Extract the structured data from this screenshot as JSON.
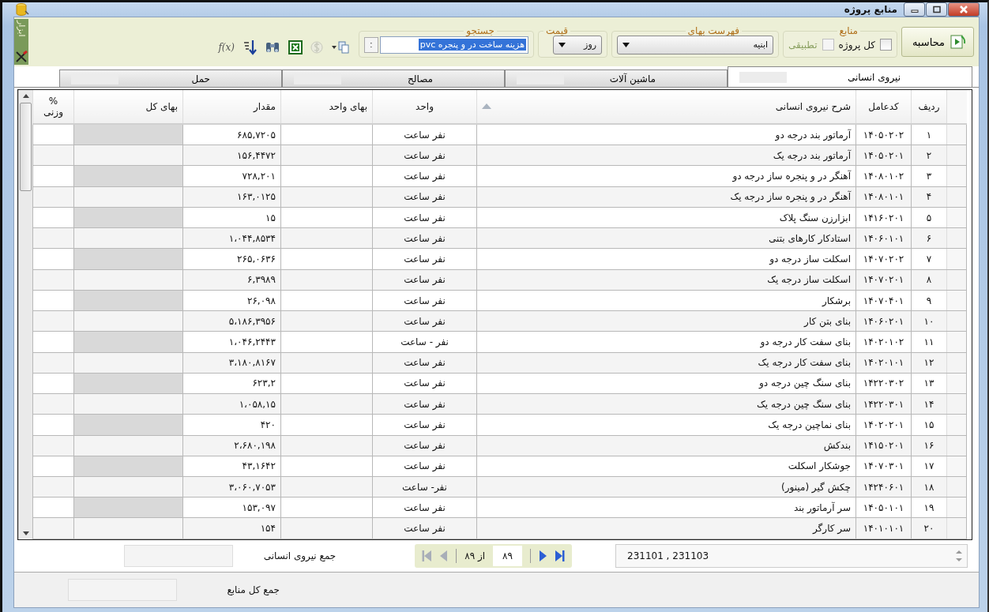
{
  "window": {
    "title": "منابع پروژه"
  },
  "toolbar": {
    "calculate": {
      "label": "محاسبه"
    },
    "resources": {
      "label": "منابع",
      "options": [
        {
          "label": "کل پروژه",
          "checked": false,
          "disabled": false
        },
        {
          "label": "تطبیقی",
          "checked": false,
          "disabled": true
        }
      ]
    },
    "price_list": {
      "label": "فهرست بهای",
      "value": "ابنیه"
    },
    "price": {
      "label": "قیمت",
      "value": "روز"
    },
    "search": {
      "label": "جستجو",
      "value": "هزینه ساخت در و پنجره pvc",
      "highlighted": true,
      "button": ":"
    },
    "tools": [
      {
        "kind": "copy",
        "disabled": false
      },
      {
        "kind": "currency",
        "disabled": true
      },
      {
        "kind": "excel",
        "disabled": false
      },
      {
        "kind": "find",
        "disabled": false
      },
      {
        "kind": "sort",
        "disabled": false
      },
      {
        "kind": "formula",
        "label": "f(x)",
        "disabled": false
      }
    ],
    "tools_panel": {
      "label": "ابزار"
    }
  },
  "tabs": [
    {
      "label": "نیروی انسانی",
      "selected": true
    },
    {
      "label": "ماشین آلات",
      "selected": false
    },
    {
      "label": "مصالح",
      "selected": false
    },
    {
      "label": "حمل",
      "selected": false
    }
  ],
  "table": {
    "columns": [
      {
        "label": "ردیف",
        "sorted": false
      },
      {
        "label": "کدعامل",
        "sorted": false
      },
      {
        "label": "شرح نیروی انسانی",
        "sorted": true
      },
      {
        "label": "واحد",
        "sorted": false
      },
      {
        "label": "بهای واحد",
        "sorted": false
      },
      {
        "label": "مقدار",
        "sorted": false
      },
      {
        "label": "بهای کل",
        "sorted": false
      },
      {
        "label": "%\nوزنی",
        "sorted": false
      }
    ],
    "rows": [
      {
        "row": "۱",
        "code": "۱۴۰۵۰۲۰۲",
        "description": "آرماتور بند درجه دو",
        "unit": "نفر ساعت",
        "quantity": "۶۸۵,۷۲۰۵"
      },
      {
        "row": "۲",
        "code": "۱۴۰۵۰۲۰۱",
        "description": "آرماتور بند درجه یک",
        "unit": "نفر ساعت",
        "quantity": "۱۵۶,۴۴۷۲"
      },
      {
        "row": "۳",
        "code": "۱۴۰۸۰۱۰۲",
        "description": "آهنگر در و پنجره ساز درجه دو",
        "unit": "نفر ساعت",
        "quantity": "۷۲۸,۲۰۱"
      },
      {
        "row": "۴",
        "code": "۱۴۰۸۰۱۰۱",
        "description": "آهنگر در و پنجره ساز درجه یک",
        "unit": "نفر ساعت",
        "quantity": "۱۶۳,۰۱۲۵"
      },
      {
        "row": "۵",
        "code": "۱۴۱۶۰۲۰۱",
        "description": "ابزارزن سنگ پلاک",
        "unit": "نفر ساعت",
        "quantity": "۱۵"
      },
      {
        "row": "۶",
        "code": "۱۴۰۶۰۱۰۱",
        "description": "استادکار کارهای بتنی",
        "unit": "نفر ساعت",
        "quantity": "۱،۰۴۴,۸۵۳۴"
      },
      {
        "row": "۷",
        "code": "۱۴۰۷۰۲۰۲",
        "description": "اسکلت ساز درجه دو",
        "unit": "نفر ساعت",
        "quantity": "۲۶۵,۰۶۳۶"
      },
      {
        "row": "۸",
        "code": "۱۴۰۷۰۲۰۱",
        "description": "اسکلت ساز درجه یک",
        "unit": "نفر ساعت",
        "quantity": "۶,۳۹۸۹"
      },
      {
        "row": "۹",
        "code": "۱۴۰۷۰۴۰۱",
        "description": "برشکار",
        "unit": "نفر ساعت",
        "quantity": "۲۶,۰۹۸"
      },
      {
        "row": "۱۰",
        "code": "۱۴۰۶۰۲۰۱",
        "description": "بنای بتن کار",
        "unit": "نفر ساعت",
        "quantity": "۵،۱۸۶,۳۹۵۶"
      },
      {
        "row": "۱۱",
        "code": "۱۴۰۲۰۱۰۲",
        "description": "بنای سفت کار درجه دو",
        "unit": "نفر - ساعت",
        "quantity": "۱،۰۴۶,۲۴۴۳"
      },
      {
        "row": "۱۲",
        "code": "۱۴۰۲۰۱۰۱",
        "description": "بنای سفت کار درجه یک",
        "unit": "نفر ساعت",
        "quantity": "۳،۱۸۰,۸۱۶۷"
      },
      {
        "row": "۱۳",
        "code": "۱۴۲۲۰۳۰۲",
        "description": "بنای سنگ چین درجه دو",
        "unit": "نفر ساعت",
        "quantity": "۶۲۳,۲"
      },
      {
        "row": "۱۴",
        "code": "۱۴۲۲۰۳۰۱",
        "description": "بنای سنگ چین درجه یک",
        "unit": "نفر ساعت",
        "quantity": "۱،۰۵۸,۱۵"
      },
      {
        "row": "۱۵",
        "code": "۱۴۰۲۰۲۰۱",
        "description": "بنای نماچین درجه یک",
        "unit": "نفر ساعت",
        "quantity": "۴۲۰"
      },
      {
        "row": "۱۶",
        "code": "۱۴۱۵۰۲۰۱",
        "description": "بندکش",
        "unit": "نفر ساعت",
        "quantity": "۲،۶۸۰,۱۹۸"
      },
      {
        "row": "۱۷",
        "code": "۱۴۰۷۰۳۰۱",
        "description": "جوشکار اسکلت",
        "unit": "نفر ساعت",
        "quantity": "۴۳,۱۶۴۲"
      },
      {
        "row": "۱۸",
        "code": "۱۴۲۴۰۶۰۱",
        "description": "چکش گیر (مینور)",
        "unit": "نفر- ساعت",
        "quantity": "۳،۰۶۰,۷۰۵۳"
      },
      {
        "row": "۱۹",
        "code": "۱۴۰۵۰۱۰۱",
        "description": "سر آرماتور بند",
        "unit": "نفر ساعت",
        "quantity": "۱۵۳,۰۹۷"
      },
      {
        "row": "۲۰",
        "code": "۱۴۰۱۰۱۰۱",
        "description": "سر کارگر",
        "unit": "نفر ساعت",
        "quantity": "۱۵۴"
      }
    ]
  },
  "codes_field": {
    "value": "231101 , 231103"
  },
  "pager": {
    "current": "۸۹",
    "total": "از ۸۹",
    "buttons": [
      {
        "kind": "last",
        "disabled": false
      },
      {
        "kind": "next",
        "disabled": false
      },
      {
        "kind": "previous",
        "disabled": true
      },
      {
        "kind": "first",
        "disabled": true
      }
    ]
  },
  "totals": [
    {
      "label": "جمع نیروی انسانی"
    },
    {
      "label": "جمع کل منابع"
    }
  ]
}
